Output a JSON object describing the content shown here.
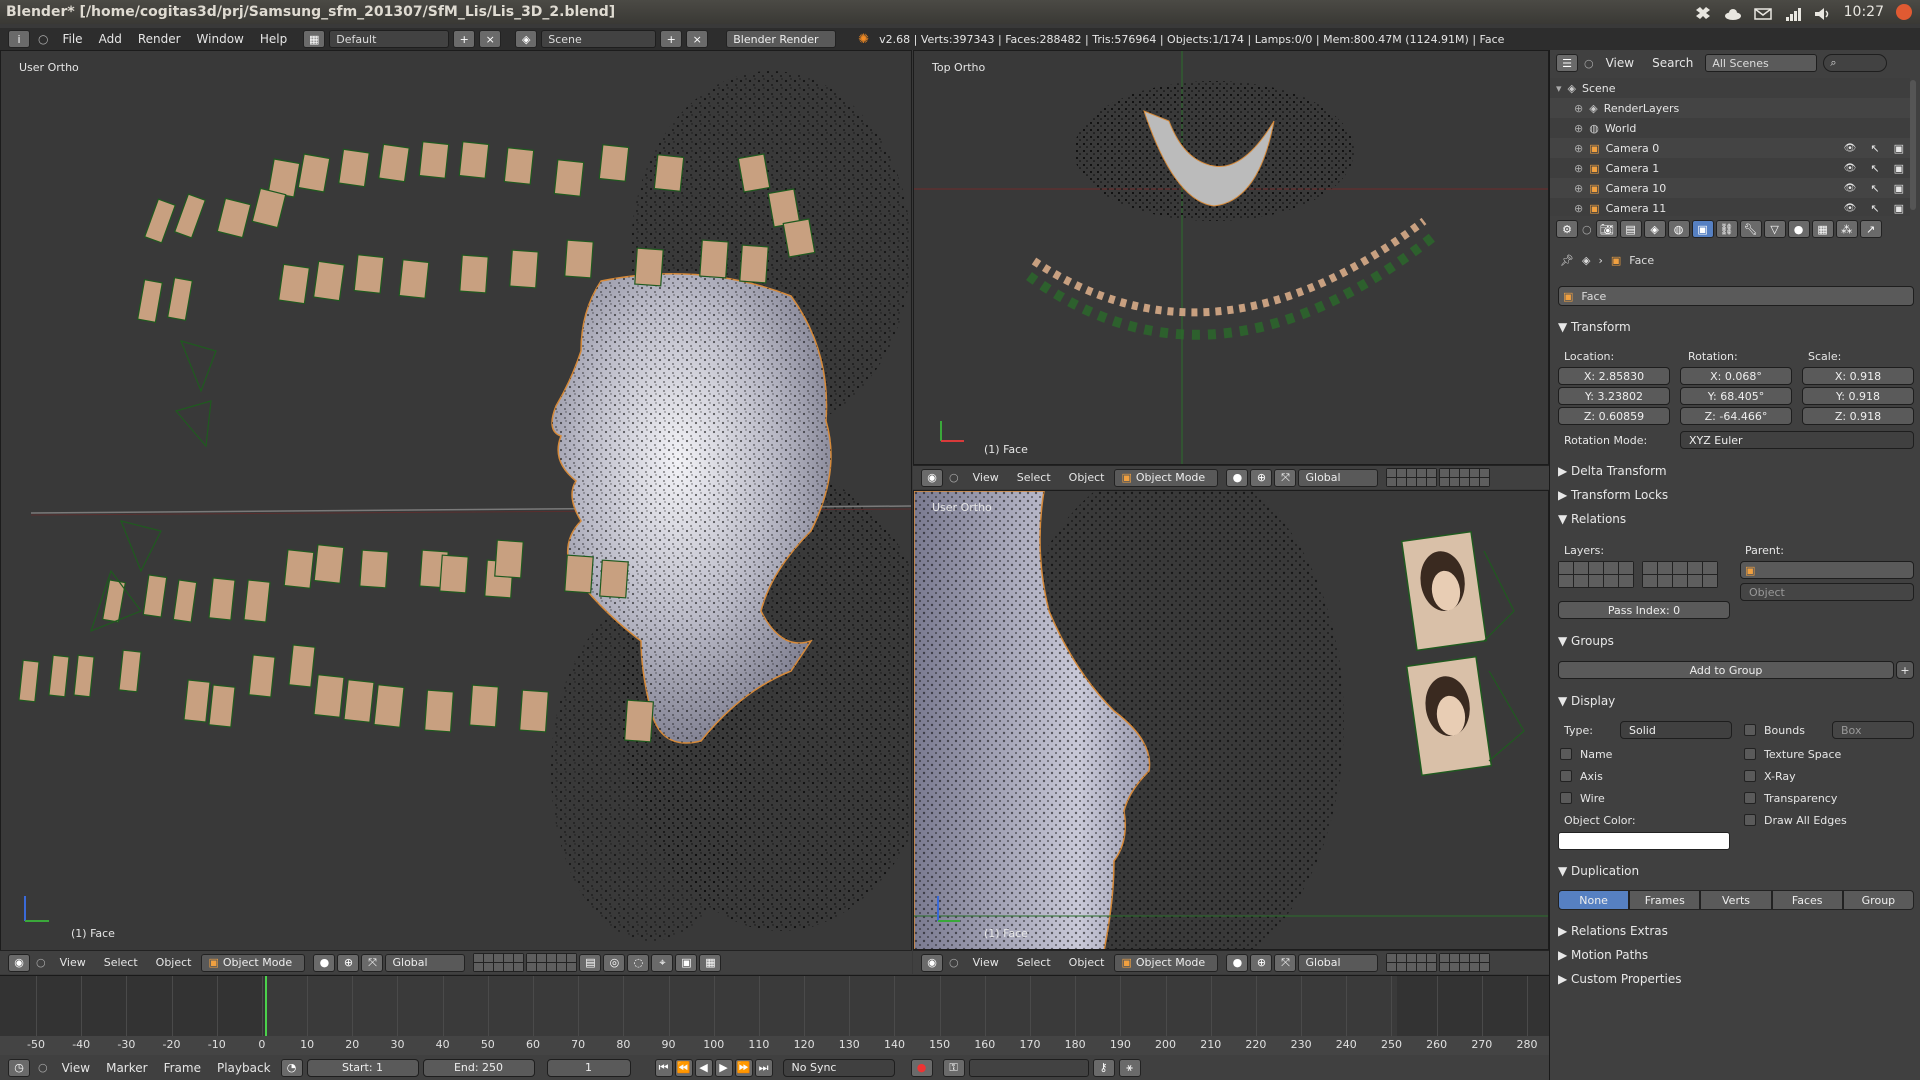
{
  "os": {
    "title": "Blender* [/home/cogitas3d/prj/Samsung_sfm_201307/SfM_Lis/Lis_3D_2.blend]",
    "clock": "10:27"
  },
  "info": {
    "menus": [
      "File",
      "Add",
      "Render",
      "Window",
      "Help"
    ],
    "layout": "Default",
    "scene": "Scene",
    "engine": "Blender Render",
    "stats": "v2.68 | Verts:397343 | Faces:288482 | Tris:576964 | Objects:1/174 | Lamps:0/0 | Mem:800.47M (1124.91M) | Face"
  },
  "viewports": {
    "left": {
      "label": "User Ortho",
      "object": "(1) Face"
    },
    "top_right": {
      "label": "Top Ortho",
      "object": "(1) Face"
    },
    "bottom_right": {
      "label": "User Ortho",
      "object": "(1) Face"
    },
    "header": {
      "menus": [
        "View",
        "Select",
        "Object"
      ],
      "mode": "Object Mode",
      "orientation": "Global"
    }
  },
  "outliner": {
    "menus": [
      "View",
      "Search"
    ],
    "filter": "All Scenes",
    "items": [
      {
        "name": "Scene",
        "depth": 0
      },
      {
        "name": "RenderLayers",
        "depth": 1
      },
      {
        "name": "World",
        "depth": 1
      },
      {
        "name": "Camera 0",
        "depth": 1
      },
      {
        "name": "Camera 1",
        "depth": 1
      },
      {
        "name": "Camera 10",
        "depth": 1
      },
      {
        "name": "Camera 11",
        "depth": 1
      }
    ]
  },
  "props": {
    "breadcrumb": "Face",
    "object_name": "Face",
    "transform": {
      "title": "Transform",
      "location_label": "Location:",
      "rotation_label": "Rotation:",
      "scale_label": "Scale:",
      "location": [
        "X: 2.85830",
        "Y: 3.23802",
        "Z: 0.60859"
      ],
      "rotation": [
        "X: 0.068°",
        "Y: 68.405°",
        "Z: -64.466°"
      ],
      "scale": [
        "X: 0.918",
        "Y: 0.918",
        "Z: 0.918"
      ],
      "rotation_mode_label": "Rotation Mode:",
      "rotation_mode": "XYZ Euler"
    },
    "delta_transform": "Delta Transform",
    "transform_locks": "Transform Locks",
    "relations": {
      "title": "Relations",
      "layers_label": "Layers:",
      "parent_label": "Parent:",
      "parent_type": "Object",
      "pass_index": "Pass Index: 0"
    },
    "groups": {
      "title": "Groups",
      "add": "Add to Group"
    },
    "display": {
      "title": "Display",
      "type_label": "Type:",
      "type": "Solid",
      "bounds": "Bounds",
      "bounds_type": "Box",
      "left": [
        "Name",
        "Axis",
        "Wire"
      ],
      "right": [
        "Texture Space",
        "X-Ray",
        "Transparency",
        "Draw All Edges"
      ],
      "object_color": "Object Color:"
    },
    "duplication": {
      "title": "Duplication",
      "tabs": [
        "None",
        "Frames",
        "Verts",
        "Faces",
        "Group"
      ]
    },
    "relations_extras": "Relations Extras",
    "motion_paths": "Motion Paths",
    "custom_properties": "Custom Properties"
  },
  "timeline": {
    "ticks": [
      -50,
      -40,
      -30,
      -20,
      -10,
      0,
      10,
      20,
      30,
      40,
      50,
      60,
      70,
      80,
      90,
      100,
      110,
      120,
      130,
      140,
      150,
      160,
      170,
      180,
      190,
      200,
      210,
      220,
      230,
      240,
      250,
      260,
      270,
      280
    ],
    "menus": [
      "View",
      "Marker",
      "Frame",
      "Playback"
    ],
    "start": "Start: 1",
    "end": "End: 250",
    "current": "1",
    "sync": "No Sync"
  }
}
